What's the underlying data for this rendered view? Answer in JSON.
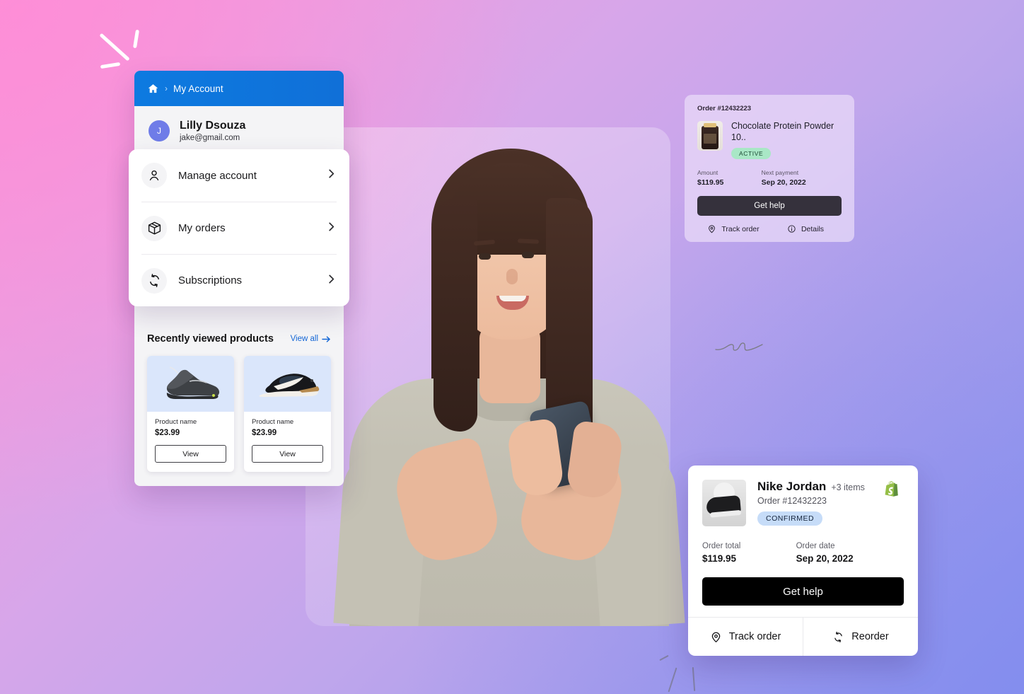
{
  "background": {
    "gradient_from": "#f79ad8",
    "gradient_mid": "#bfa6ec",
    "gradient_to": "#8e94ec"
  },
  "account_panel": {
    "breadcrumb": {
      "home_icon": "home-icon",
      "separator": "›",
      "current": "My Account"
    },
    "user": {
      "initial": "J",
      "name": "Lilly Dsouza",
      "email": "jake@gmail.com",
      "avatar_color": "#6f7ce8"
    },
    "menu": [
      {
        "icon": "person-icon",
        "label": "Manage account",
        "chevron": "chevron-right-icon"
      },
      {
        "icon": "package-icon",
        "label": "My orders",
        "chevron": "chevron-right-icon"
      },
      {
        "icon": "refresh-icon",
        "label": "Subscriptions",
        "chevron": "chevron-right-icon"
      }
    ],
    "recently_viewed": {
      "title": "Recently viewed products",
      "view_all_label": "View all",
      "view_all_icon": "arrow-right-icon",
      "products": [
        {
          "name": "Product name",
          "price": "$23.99",
          "button": "View"
        },
        {
          "name": "Product name",
          "price": "$23.99",
          "button": "View"
        }
      ]
    }
  },
  "subscription_card": {
    "order_number": "Order #12432223",
    "product_title": "Chocolate Protein Powder 10..",
    "status_badge": "ACTIVE",
    "status_color": "#a9e7c6",
    "amount_label": "Amount",
    "amount_value": "$119.95",
    "next_payment_label": "Next payment",
    "next_payment_value": "Sep 20, 2022",
    "primary_button": "Get help",
    "actions": [
      {
        "icon": "location-pin-icon",
        "label": "Track order"
      },
      {
        "icon": "info-icon",
        "label": "Details"
      }
    ]
  },
  "order_card": {
    "product_title": "Nike Jordan",
    "extra_items": "+3 items",
    "order_number": "Order #12432223",
    "status_badge": "CONFIRMED",
    "status_color": "#c6dcf8",
    "brand_icon": "shopify-icon",
    "order_total_label": "Order total",
    "order_total_value": "$119.95",
    "order_date_label": "Order date",
    "order_date_value": "Sep 20, 2022",
    "primary_button": "Get help",
    "actions": [
      {
        "icon": "location-pin-icon",
        "label": "Track order"
      },
      {
        "icon": "refresh-icon",
        "label": "Reorder"
      }
    ]
  }
}
